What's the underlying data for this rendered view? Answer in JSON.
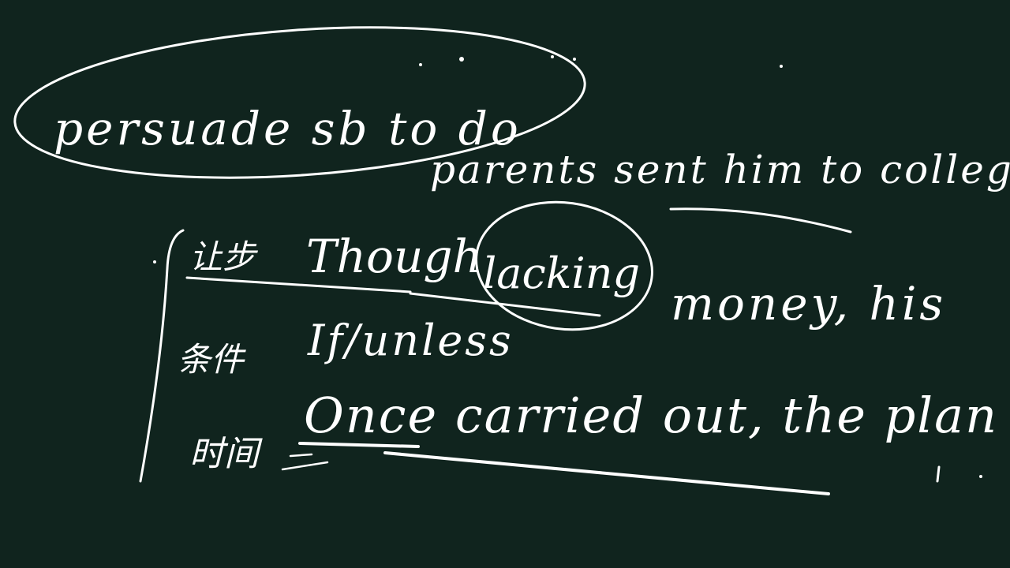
{
  "board": {
    "background_color": "#10241e",
    "ink_color": "#ffffff",
    "lines": {
      "phrase": "persuade sb to do",
      "sentence1": "parents sent him to college.",
      "cond1_label": "让步",
      "cond1": "Though",
      "lacking": "lacking",
      "money": "money, his",
      "cond2_label": "条件",
      "cond2": "If/unless",
      "cond3_label": "时间",
      "cond3": "Once carried out, the plan"
    }
  }
}
